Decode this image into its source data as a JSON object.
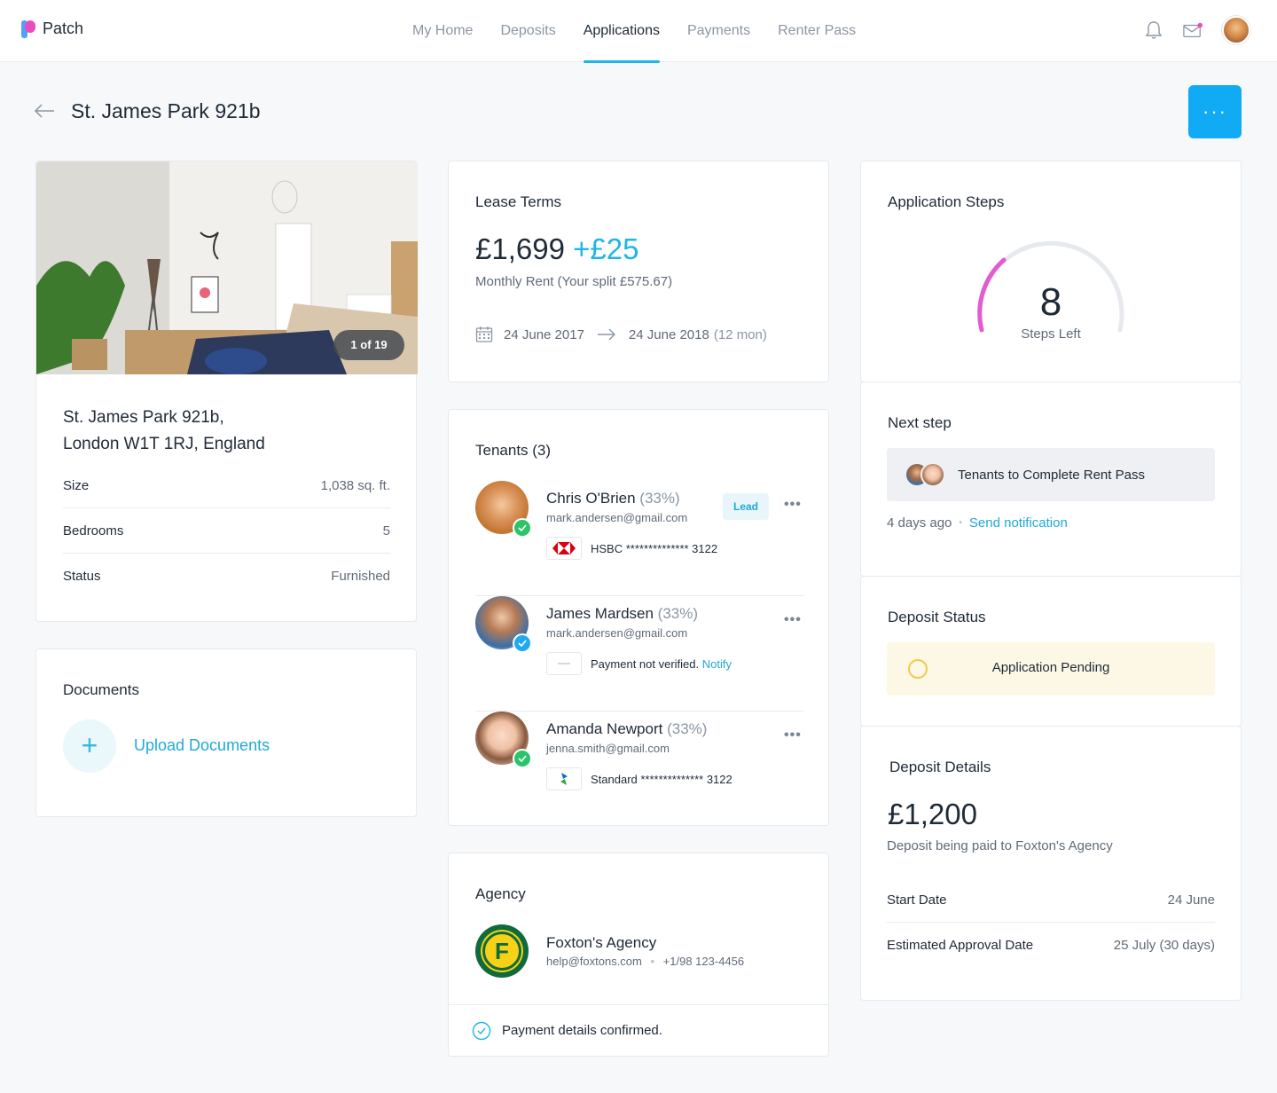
{
  "app": {
    "name": "Patch"
  },
  "nav": {
    "items": [
      {
        "label": "My Home",
        "active": false
      },
      {
        "label": "Deposits",
        "active": false
      },
      {
        "label": "Applications",
        "active": true
      },
      {
        "label": "Payments",
        "active": false
      },
      {
        "label": "Renter Pass",
        "active": false
      }
    ],
    "icons": [
      "bell-icon",
      "mail-icon",
      "user-avatar"
    ]
  },
  "page": {
    "title": "St. James Park 921b",
    "more_label": "···"
  },
  "property": {
    "photo_counter": "1 of 19",
    "address_line1": "St. James Park 921b,",
    "address_line2": "London W1T 1RJ, England",
    "specs": [
      {
        "label": "Size",
        "value": "1,038 sq. ft."
      },
      {
        "label": "Bedrooms",
        "value": "5"
      },
      {
        "label": "Status",
        "value": "Furnished"
      }
    ]
  },
  "documents": {
    "title": "Documents",
    "upload_label": "Upload Documents"
  },
  "lease": {
    "title": "Lease Terms",
    "rent": "£1,699",
    "extra": "+£25",
    "note": "Monthly Rent (Your split £575.67)",
    "start": "24 June 2017",
    "end": "24 June 2018",
    "duration": "(12 mon)"
  },
  "tenants": {
    "title": "Tenants (3)",
    "list": [
      {
        "name": "Chris O'Brien",
        "share": "(33%)",
        "email": "mark.andersen@gmail.com",
        "lead": "Lead",
        "bank": "HSBC ************** 3122",
        "verified_color": "#2bc46b"
      },
      {
        "name": "James Mardsen",
        "share": "(33%)",
        "email": "mark.andersen@gmail.com",
        "bank": "Payment not verified.",
        "action": "Notify",
        "verified_color": "#1faaf0"
      },
      {
        "name": "Amanda Newport",
        "share": "(33%)",
        "email": "jenna.smith@gmail.com",
        "bank": "Standard ************** 3122",
        "verified_color": "#2bc46b"
      }
    ]
  },
  "agency": {
    "title": "Agency",
    "name": "Foxton's Agency",
    "email": "help@foxtons.com",
    "phone": "+1/98 123-4456",
    "logo_letter": "F",
    "footer": "Payment details confirmed."
  },
  "steps": {
    "title": "Application Steps",
    "count": "8",
    "label": "Steps Left",
    "progress": 0.2
  },
  "next_step": {
    "title": "Next step",
    "task": "Tenants to Complete Rent Pass",
    "time": "4 days ago",
    "action": "Send notification"
  },
  "deposit_status": {
    "title": "Deposit Status",
    "status": "Application Pending"
  },
  "deposit_details": {
    "title": "Deposit Details",
    "amount": "£1,200",
    "note": "Deposit being paid to Foxton's Agency",
    "rows": [
      {
        "label": "Start Date",
        "value": "24 June"
      },
      {
        "label": "Estimated Approval Date",
        "value": "25 July (30 days)"
      }
    ]
  },
  "colors": {
    "accent": "#1fb5e6",
    "primary_button": "#10aaf5",
    "gauge_progress": "#e45bd0",
    "pending": "#f2c94c"
  }
}
